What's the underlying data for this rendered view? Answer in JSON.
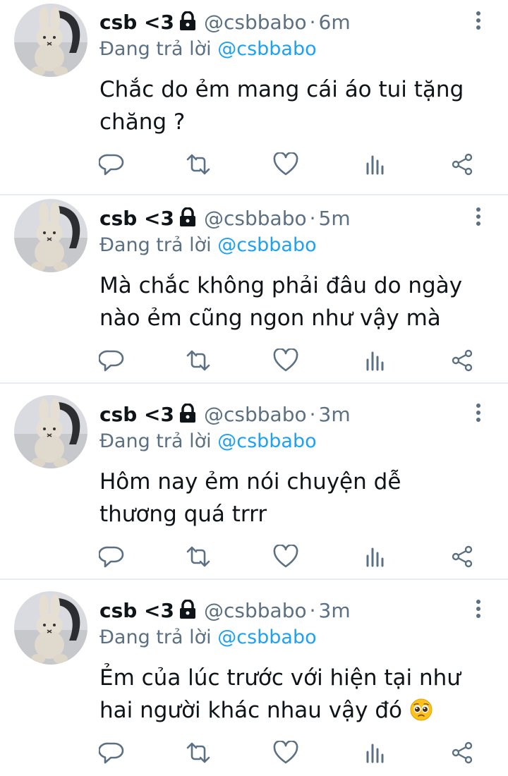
{
  "tweets": [
    {
      "name": "csb <3",
      "handle": "@csbbabo",
      "time": "6m",
      "reply_prefix": "Đang trả lời",
      "reply_to": "@csbbabo",
      "text": "Chắc do ẻm mang cái áo tui tặng chăng ?"
    },
    {
      "name": "csb <3",
      "handle": "@csbbabo",
      "time": "5m",
      "reply_prefix": "Đang trả lời",
      "reply_to": "@csbbabo",
      "text": "Mà chắc không phải đâu do ngày nào ẻm cũng ngon như vậy mà"
    },
    {
      "name": "csb <3",
      "handle": "@csbbabo",
      "time": "3m",
      "reply_prefix": "Đang trả lời",
      "reply_to": "@csbbabo",
      "text": "Hôm nay ẻm nói chuyện dễ thương quá trrr"
    },
    {
      "name": "csb <3",
      "handle": "@csbbabo",
      "time": "3m",
      "reply_prefix": "Đang trả lời",
      "reply_to": "@csbbabo",
      "text": "Ẻm của lúc trước với hiện tại như hai người khác nhau vậy đó"
    }
  ],
  "separator": "·",
  "emoji": "pleading-face-emoji",
  "icons": [
    "reply-icon",
    "retweet-icon",
    "like-icon",
    "analytics-icon",
    "share-icon",
    "more-options-icon",
    "lock-icon"
  ],
  "colors": {
    "mention": "#1da1f2",
    "secondary_text": "#5b7083",
    "primary_text": "#0f1419",
    "divider": "#e6ecf0"
  }
}
